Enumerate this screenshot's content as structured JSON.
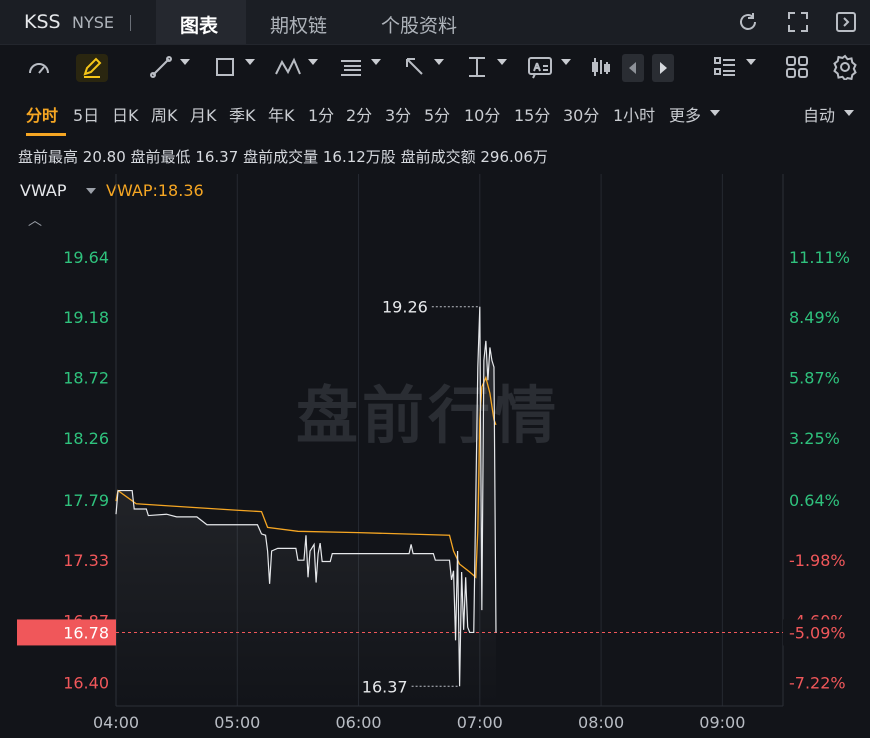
{
  "header": {
    "ticker": "KSS",
    "exchange": "NYSE",
    "tabs": [
      {
        "label": "图表",
        "active": true
      },
      {
        "label": "期权链",
        "active": false
      },
      {
        "label": "个股资料",
        "active": false
      }
    ],
    "icons": [
      "refresh-icon",
      "fullscreen-icon",
      "collapse-panel-icon"
    ]
  },
  "toolbar": {
    "icons": [
      "indicator-gauge-icon",
      "draw-pen-icon",
      "line-tool-icon",
      "rectangle-tool-icon",
      "pattern-tool-icon",
      "fib-tool-icon",
      "arrow-tool-icon",
      "range-tool-icon",
      "text-tool-icon",
      "candle-style-icon",
      "prev-icon",
      "next-icon",
      "layout-list-icon",
      "grid-layout-icon",
      "settings-icon"
    ]
  },
  "periods": {
    "items": [
      "分时",
      "5日",
      "日K",
      "周K",
      "月K",
      "季K",
      "年K",
      "1分",
      "2分",
      "3分",
      "5分",
      "10分",
      "15分",
      "30分",
      "1小时",
      "更多"
    ],
    "active": "分时",
    "right_label": "自动"
  },
  "stats": {
    "high_label": "盘前最高",
    "high": "20.80",
    "low_label": "盘前最低",
    "low": "16.37",
    "volume_label": "盘前成交量",
    "volume": "16.12万股",
    "amount_label": "盘前成交额",
    "amount": "296.06万"
  },
  "indicator": {
    "name": "VWAP",
    "value_text": "VWAP:18.36"
  },
  "watermark": "盘前行情",
  "colors": {
    "background": "#121419",
    "up": "#2fc27d",
    "down": "#f0575a",
    "vwap": "#f5a623",
    "price_line": "#e6e8eb",
    "current_price_bg": "#f0575a"
  },
  "chart_data": {
    "type": "line",
    "x_ticks": [
      "04:00",
      "05:00",
      "06:00",
      "07:00",
      "08:00",
      "09:00"
    ],
    "x_range": [
      "04:00",
      "09:30"
    ],
    "y_ticks": [
      "19.64",
      "19.18",
      "18.72",
      "18.26",
      "17.79",
      "17.33",
      "16.87",
      "16.40"
    ],
    "y_ticks_right": [
      "11.11%",
      "8.49%",
      "5.87%",
      "3.25%",
      "0.64%",
      "-1.98%",
      "-4.60%",
      "-7.22%"
    ],
    "ylim": [
      16.22,
      19.92
    ],
    "current_price": "16.78",
    "current_pct": "-5.09%",
    "annotations": [
      {
        "label": "19.26",
        "time": "07:00",
        "value": 19.26
      },
      {
        "label": "16.37",
        "time": "06:50",
        "value": 16.37
      }
    ],
    "series": [
      {
        "name": "price",
        "points": [
          [
            "04:00",
            17.68
          ],
          [
            "04:01",
            17.86
          ],
          [
            "04:08",
            17.86
          ],
          [
            "04:09",
            17.72
          ],
          [
            "04:15",
            17.72
          ],
          [
            "04:16",
            17.67
          ],
          [
            "04:25",
            17.68
          ],
          [
            "04:30",
            17.66
          ],
          [
            "04:40",
            17.66
          ],
          [
            "04:45",
            17.6
          ],
          [
            "04:55",
            17.6
          ],
          [
            "05:00",
            17.6
          ],
          [
            "05:10",
            17.6
          ],
          [
            "05:12",
            17.53
          ],
          [
            "05:14",
            17.52
          ],
          [
            "05:15",
            17.4
          ],
          [
            "05:16",
            17.15
          ],
          [
            "05:17",
            17.4
          ],
          [
            "05:20",
            17.42
          ],
          [
            "05:29",
            17.42
          ],
          [
            "05:30",
            17.33
          ],
          [
            "05:33",
            17.33
          ],
          [
            "05:34",
            17.52
          ],
          [
            "05:35",
            17.2
          ],
          [
            "05:36",
            17.4
          ],
          [
            "05:38",
            17.45
          ],
          [
            "05:39",
            17.16
          ],
          [
            "05:40",
            17.38
          ],
          [
            "05:41",
            17.46
          ],
          [
            "05:42",
            17.32
          ],
          [
            "05:46",
            17.32
          ],
          [
            "05:47",
            17.38
          ],
          [
            "06:00",
            17.38
          ],
          [
            "06:25",
            17.38
          ],
          [
            "06:26",
            17.45
          ],
          [
            "06:27",
            17.38
          ],
          [
            "06:37",
            17.38
          ],
          [
            "06:38",
            17.33
          ],
          [
            "06:45",
            17.33
          ],
          [
            "06:46",
            17.18
          ],
          [
            "06:47",
            17.25
          ],
          [
            "06:48",
            16.72
          ],
          [
            "06:49",
            17.4
          ],
          [
            "06:50",
            16.37
          ],
          [
            "06:51",
            17.24
          ],
          [
            "06:52",
            16.8
          ],
          [
            "06:53",
            17.2
          ],
          [
            "06:54",
            16.82
          ],
          [
            "06:55",
            16.78
          ],
          [
            "06:57",
            16.78
          ],
          [
            "06:59",
            18.8
          ],
          [
            "07:00",
            19.26
          ],
          [
            "07:01",
            16.95
          ],
          [
            "07:02",
            18.85
          ],
          [
            "07:03",
            19.0
          ],
          [
            "07:04",
            18.7
          ],
          [
            "07:05",
            18.95
          ],
          [
            "07:06",
            18.85
          ],
          [
            "07:07",
            18.8
          ],
          [
            "07:08",
            16.78
          ]
        ]
      },
      {
        "name": "VWAP",
        "points": [
          [
            "04:00",
            17.78
          ],
          [
            "04:01",
            17.86
          ],
          [
            "04:10",
            17.76
          ],
          [
            "04:30",
            17.74
          ],
          [
            "05:00",
            17.71
          ],
          [
            "05:12",
            17.7
          ],
          [
            "05:15",
            17.58
          ],
          [
            "05:30",
            17.55
          ],
          [
            "06:00",
            17.54
          ],
          [
            "06:45",
            17.52
          ],
          [
            "06:47",
            17.4
          ],
          [
            "06:50",
            17.3
          ],
          [
            "06:55",
            17.24
          ],
          [
            "06:58",
            17.2
          ],
          [
            "06:59",
            17.55
          ],
          [
            "07:00",
            18.4
          ],
          [
            "07:01",
            18.65
          ],
          [
            "07:03",
            18.72
          ],
          [
            "07:05",
            18.6
          ],
          [
            "07:07",
            18.4
          ],
          [
            "07:08",
            18.36
          ]
        ]
      }
    ]
  }
}
